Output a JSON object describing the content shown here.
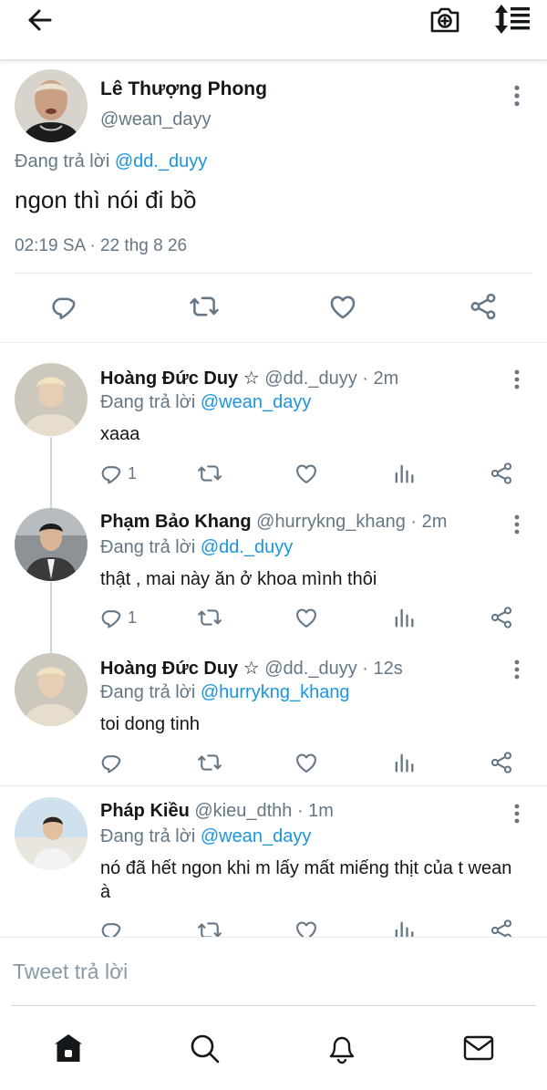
{
  "header": {
    "back_icon": "arrow-left-icon",
    "camera_icon": "camera-plus-icon",
    "sort_icon": "sort-icon"
  },
  "main_tweet": {
    "name": "Lê Thượng Phong",
    "handle": "@wean_dayy",
    "replying_prefix": "Đang trả lời ",
    "replying_to": "@dd._duyy",
    "text": "ngon thì nói đi bồ",
    "timestamp": "02:19 SA · 22 thg 8 26"
  },
  "replies": [
    {
      "name": "Hoàng Đức Duy ☆",
      "handle": " @dd._duyy · 2m",
      "replying_prefix": "Đang trả lời ",
      "replying_to": "@wean_dayy",
      "text": "xaaa",
      "reply_count": "1"
    },
    {
      "name": "Phạm Bảo Khang",
      "handle": " @hurrykng_khang · 2m",
      "replying_prefix": "Đang trả lời ",
      "replying_to": "@dd._duyy",
      "text": "thật , mai này ăn ở khoa mình thôi",
      "reply_count": "1"
    },
    {
      "name": "Hoàng Đức Duy ☆",
      "handle": " @dd._duyy · 12s",
      "replying_prefix": "Đang trả lời ",
      "replying_to": "@hurrykng_khang",
      "text": "toi dong tinh",
      "reply_count": ""
    },
    {
      "name": "Pháp Kiều",
      "handle": " @kieu_dthh · 1m",
      "replying_prefix": "Đang trả lời ",
      "replying_to": "@wean_dayy",
      "text": "nó đã hết ngon khi m lấy mất miếng thịt của t wean à",
      "reply_count": ""
    }
  ],
  "compose": {
    "placeholder": "Tweet trả lời"
  },
  "bottom_nav": {
    "items": [
      "home-icon",
      "search-icon",
      "notifications-icon",
      "messages-icon"
    ]
  },
  "colors": {
    "accent": "#1b95e0",
    "secondary_text": "#657786",
    "primary_text": "#14171a"
  }
}
